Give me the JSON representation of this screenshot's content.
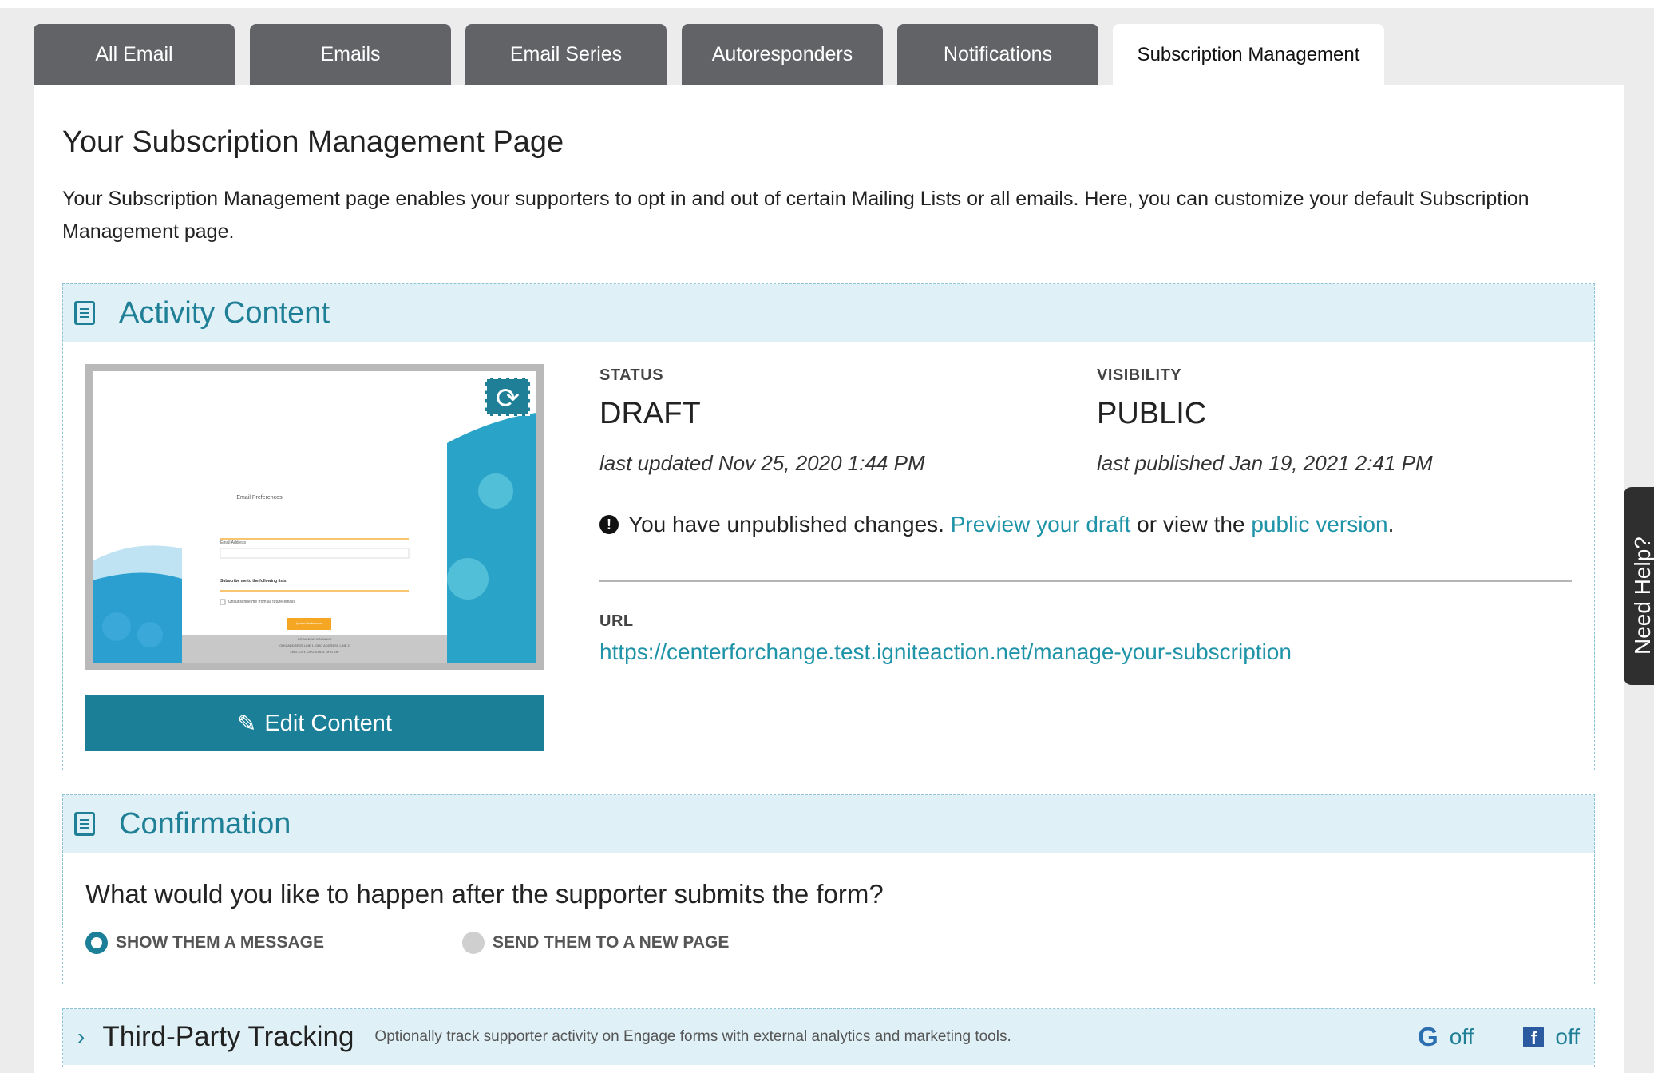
{
  "tabs": [
    {
      "label": "All Email"
    },
    {
      "label": "Emails"
    },
    {
      "label": "Email Series"
    },
    {
      "label": "Autoresponders"
    },
    {
      "label": "Notifications"
    },
    {
      "label": "Subscription Management",
      "active": true
    }
  ],
  "page": {
    "title": "Your Subscription Management Page",
    "description": "Your Subscription Management page enables your supporters to opt in and out of certain Mailing Lists or all emails. Here, you can customize your default Subscription Management page."
  },
  "activity_content": {
    "title": "Activity Content",
    "edit_label": "Edit Content",
    "status_label": "STATUS",
    "status_value": "DRAFT",
    "last_updated": "last updated Nov 25, 2020 1:44 PM",
    "visibility_label": "VISIBILITY",
    "visibility_value": "PUBLIC",
    "last_published": "last published Jan 19, 2021 2:41 PM",
    "notice_text": "You have unpublished changes.",
    "preview_link": "Preview your draft",
    "notice_mid": "or view the",
    "public_link": "public version",
    "notice_end": ".",
    "url_label": "URL",
    "url": "https://centerforchange.test.igniteaction.net/manage-your-subscription",
    "preview_thumb": {
      "heading": "Email Preferences",
      "field_label": "Email Address",
      "list_label": "Subscribe me to the following lists:",
      "checkbox_label": "Unsubscribe me from all future emails",
      "button_label": "Update Preferences",
      "footer_lines": [
        "ORGANIZATION NAME",
        "ORG ADDRESS LINE 1, ORG ADDRESS LINE 2",
        "ORG CITY, ORG STATE ORG ZIP"
      ]
    }
  },
  "confirmation": {
    "title": "Confirmation",
    "question": "What would you like to happen after the supporter submits the form?",
    "option_message": "SHOW THEM A MESSAGE",
    "option_page": "SEND THEM TO A NEW PAGE",
    "selected": "SHOW THEM A MESSAGE"
  },
  "tracking": {
    "title": "Third-Party Tracking",
    "subtitle": "Optionally track supporter activity on Engage forms with external analytics and marketing tools.",
    "google_status": "off",
    "facebook_status": "off"
  },
  "need_help": "Need Help?",
  "colors": {
    "accent": "#1f7f96",
    "tab_bg": "#616366",
    "link": "#1f93a8"
  }
}
